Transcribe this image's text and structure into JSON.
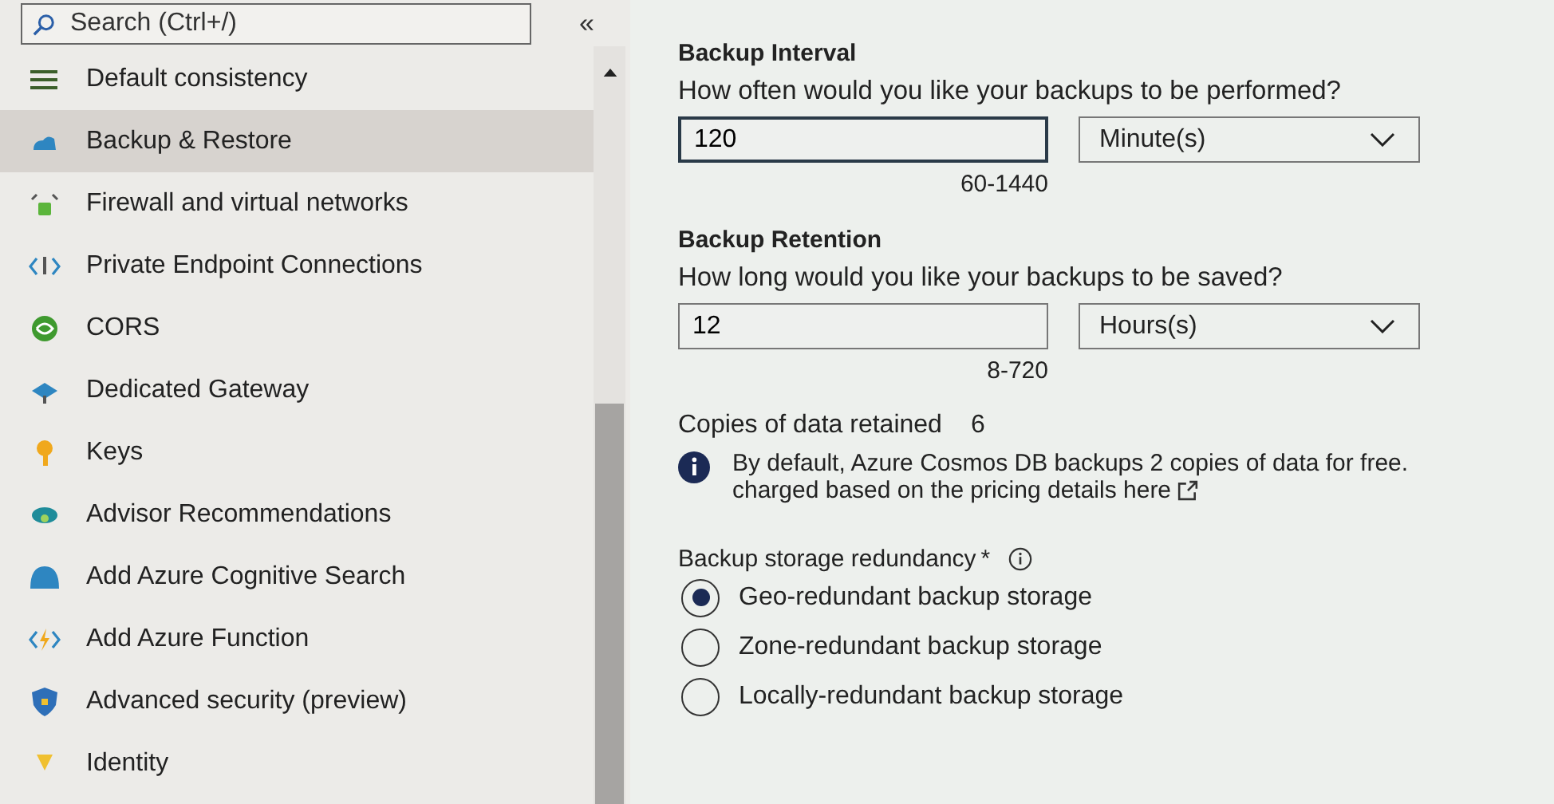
{
  "sidebar": {
    "search": {
      "placeholder": "Search (Ctrl+/)"
    },
    "collapse": "«",
    "items": [
      {
        "label": "Default consistency",
        "selected": false
      },
      {
        "label": "Backup & Restore",
        "selected": true
      },
      {
        "label": "Firewall and virtual networks",
        "selected": false
      },
      {
        "label": "Private Endpoint Connections",
        "selected": false
      },
      {
        "label": "CORS",
        "selected": false
      },
      {
        "label": "Dedicated Gateway",
        "selected": false
      },
      {
        "label": "Keys",
        "selected": false
      },
      {
        "label": "Advisor Recommendations",
        "selected": false
      },
      {
        "label": "Add Azure Cognitive Search",
        "selected": false
      },
      {
        "label": "Add Azure Function",
        "selected": false
      },
      {
        "label": "Advanced security (preview)",
        "selected": false
      },
      {
        "label": "Identity",
        "selected": false
      }
    ]
  },
  "interval": {
    "heading": "Backup Interval",
    "question": "How often would you like your backups to be performed?",
    "value": "120",
    "unit": "Minute(s)",
    "range": "60-1440"
  },
  "retention": {
    "heading": "Backup Retention",
    "question": "How long would you like your backups to be saved?",
    "value": "12",
    "unit": "Hours(s)",
    "range": "8-720"
  },
  "copies": {
    "label": "Copies of data retained",
    "value": "6"
  },
  "info": {
    "line_1": "By default, Azure Cosmos DB backups 2 copies of data for free.",
    "line_2": "charged based on the",
    "link": "pricing details here"
  },
  "redundancy": {
    "label": "Backup storage redundancy",
    "required": "*",
    "options": [
      {
        "label": "Geo-redundant backup storage",
        "selected": true
      },
      {
        "label": "Zone-redundant backup storage",
        "selected": false
      },
      {
        "label": "Locally-redundant backup storage",
        "selected": false
      }
    ]
  }
}
